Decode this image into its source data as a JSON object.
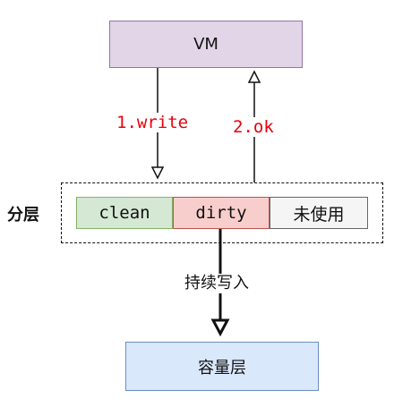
{
  "nodes": {
    "vm": "VM",
    "layer_group_label": "分层",
    "segments": [
      "clean",
      "dirty",
      "未使用"
    ],
    "capacity_layer": "容量层"
  },
  "edges": {
    "write": "1.write",
    "ok": "2.ok",
    "persist": "持续写入"
  },
  "colors": {
    "vm_fill": "#e1d5e7",
    "vm_stroke": "#9673a6",
    "clean_fill": "#d5e8d4",
    "clean_stroke": "#82b366",
    "dirty_fill": "#f8cecc",
    "dirty_stroke": "#b85450",
    "unused_fill": "#f5f5f5",
    "unused_stroke": "#666666",
    "capacity_fill": "#dae8fc",
    "capacity_stroke": "#6c8ebf",
    "edge_label_color": "#e8000b"
  }
}
